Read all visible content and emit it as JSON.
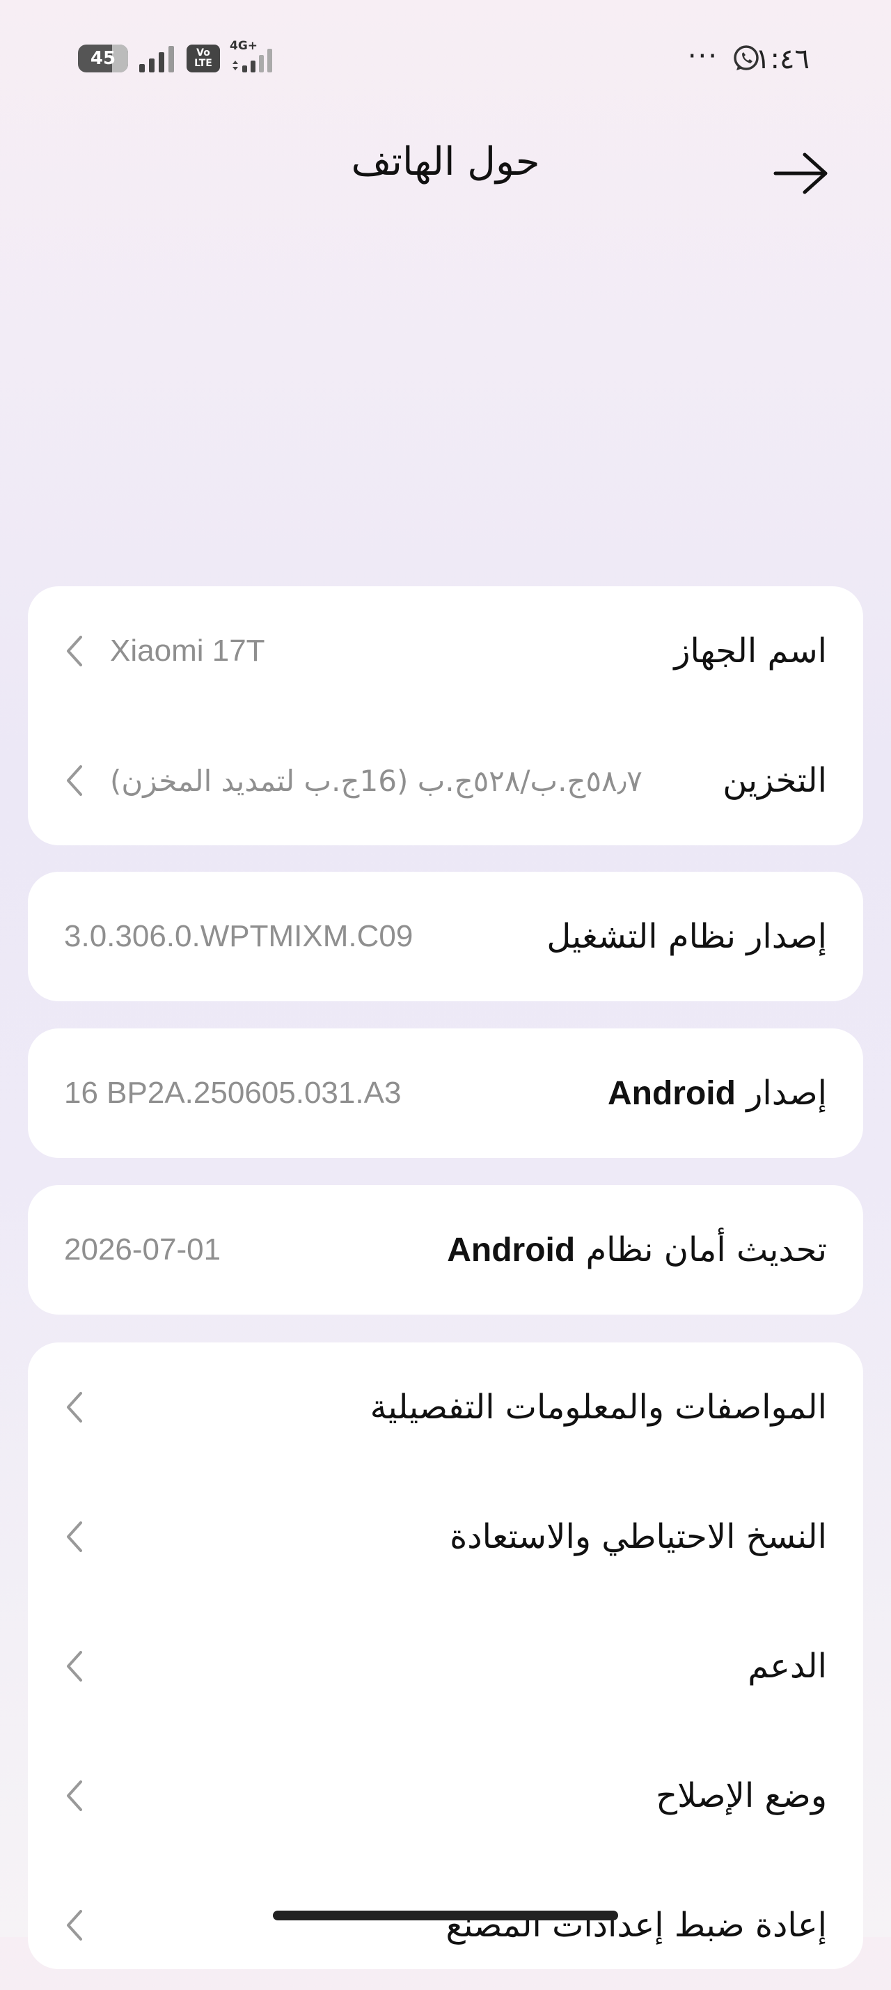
{
  "status_bar": {
    "time": "١:٤٦",
    "more": "···",
    "battery_level": "45",
    "volte_label_1": "Vo",
    "volte_label_2": "LTE",
    "network_type": "4G+"
  },
  "header": {
    "title": "حول الهاتف"
  },
  "device_card": {
    "device_name_label": "اسم الجهاز",
    "device_name_value": "Xiaomi 17T",
    "storage_label": "التخزين",
    "storage_value": "٥٨٫٧ج.ب/٥٢٨ج.ب (16ج.ب لتمديد المخزن)"
  },
  "os_version": {
    "label": "إصدار نظام التشغيل",
    "value": "3.0.306.0.WPTMIXM.C09"
  },
  "android_version": {
    "label_prefix": "إصدار",
    "label_brand": "Android",
    "value": "16 BP2A.250605.031.A3"
  },
  "security_update": {
    "label_prefix": "تحديث أمان نظام",
    "label_brand": "Android",
    "value": "2026-07-01"
  },
  "menu": {
    "items": [
      {
        "label": "المواصفات والمعلومات التفصيلية"
      },
      {
        "label": "النسخ الاحتياطي والاستعادة"
      },
      {
        "label": "الدعم"
      },
      {
        "label": "وضع الإصلاح"
      },
      {
        "label": "إعادة ضبط إعدادات المصنع"
      }
    ]
  },
  "colors": {
    "card_background": "#ffffff",
    "secondary_text": "#8f8f8f",
    "primary_text": "#111111"
  }
}
